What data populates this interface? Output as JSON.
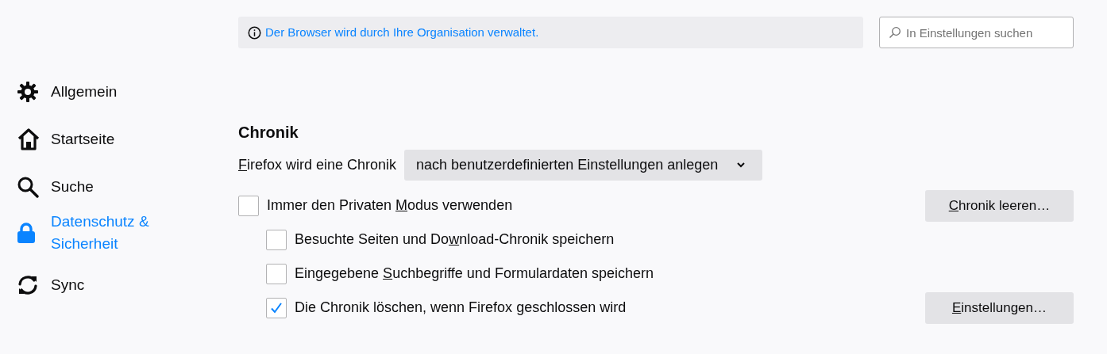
{
  "sidebar": {
    "items": [
      {
        "kind": "gear",
        "label": "Allgemein",
        "selected": false
      },
      {
        "kind": "home",
        "label": "Startseite",
        "selected": false
      },
      {
        "kind": "search",
        "label": "Suche",
        "selected": false
      },
      {
        "kind": "lock",
        "label": "Datenschutz & Sicherheit",
        "selected": true
      },
      {
        "kind": "sync",
        "label": "Sync",
        "selected": false
      }
    ]
  },
  "banner": {
    "text": "Der Browser wird durch Ihre Organisation verwaltet."
  },
  "search": {
    "placeholder": "In Einstellungen suchen"
  },
  "section": {
    "title": "Chronik",
    "history_mode": {
      "label": {
        "key": "F",
        "after": "irefox wird eine Chronik"
      },
      "value": "nach benutzerdefinierten Einstellungen anlegen"
    },
    "options": [
      {
        "label": {
          "before": "Immer den Privaten ",
          "key": "M",
          "after": "odus verwenden"
        },
        "checked": false,
        "button": {
          "key": "C",
          "after": "hronik leeren…"
        },
        "children": [
          {
            "label": {
              "before": "Besuchte Seiten und Do",
              "key": "w",
              "after": "nload-Chronik speichern"
            },
            "checked": false
          },
          {
            "label": {
              "before": "Eingegebene ",
              "key": "S",
              "after": "uchbegriffe und Formulardaten speichern"
            },
            "checked": false
          },
          {
            "label": {
              "before": "Die Chronik löschen, wenn Firefox ",
              "key": "g",
              "after": "eschlossen wird"
            },
            "checked": true,
            "button": {
              "key": "E",
              "after": "instellungen…"
            }
          }
        ]
      }
    ]
  }
}
